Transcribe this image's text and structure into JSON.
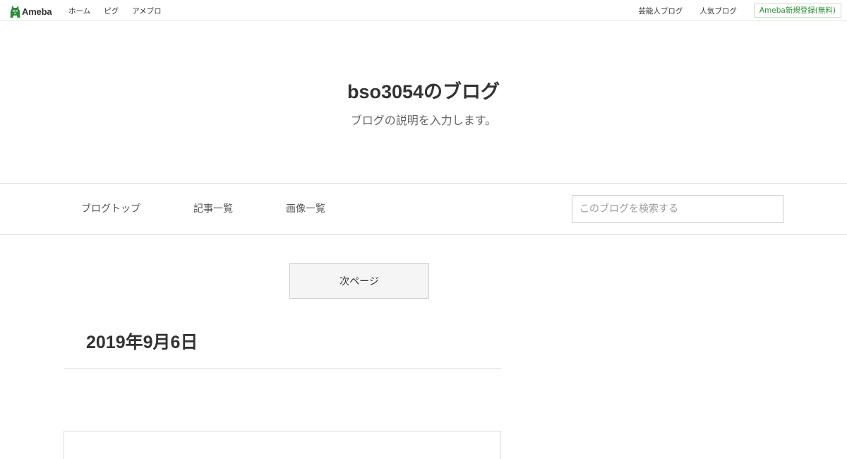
{
  "topbar": {
    "logo_text": "Ameba",
    "left_links": [
      "ホーム",
      "ピグ",
      "アメブロ"
    ],
    "right_links": [
      "芸能人ブログ",
      "人気ブログ"
    ],
    "register_label": "Ameba新規登録(無料)"
  },
  "blog": {
    "title": "bso3054のブログ",
    "description": "ブログの説明を入力します。"
  },
  "blog_nav": {
    "items": [
      "ブログトップ",
      "記事一覧",
      "画像一覧"
    ],
    "search_placeholder": "このブログを検索する"
  },
  "main": {
    "next_page_label": "次ページ",
    "date_heading": "2019年9月6日"
  },
  "colors": {
    "accent_green": "#2d8c3c"
  }
}
